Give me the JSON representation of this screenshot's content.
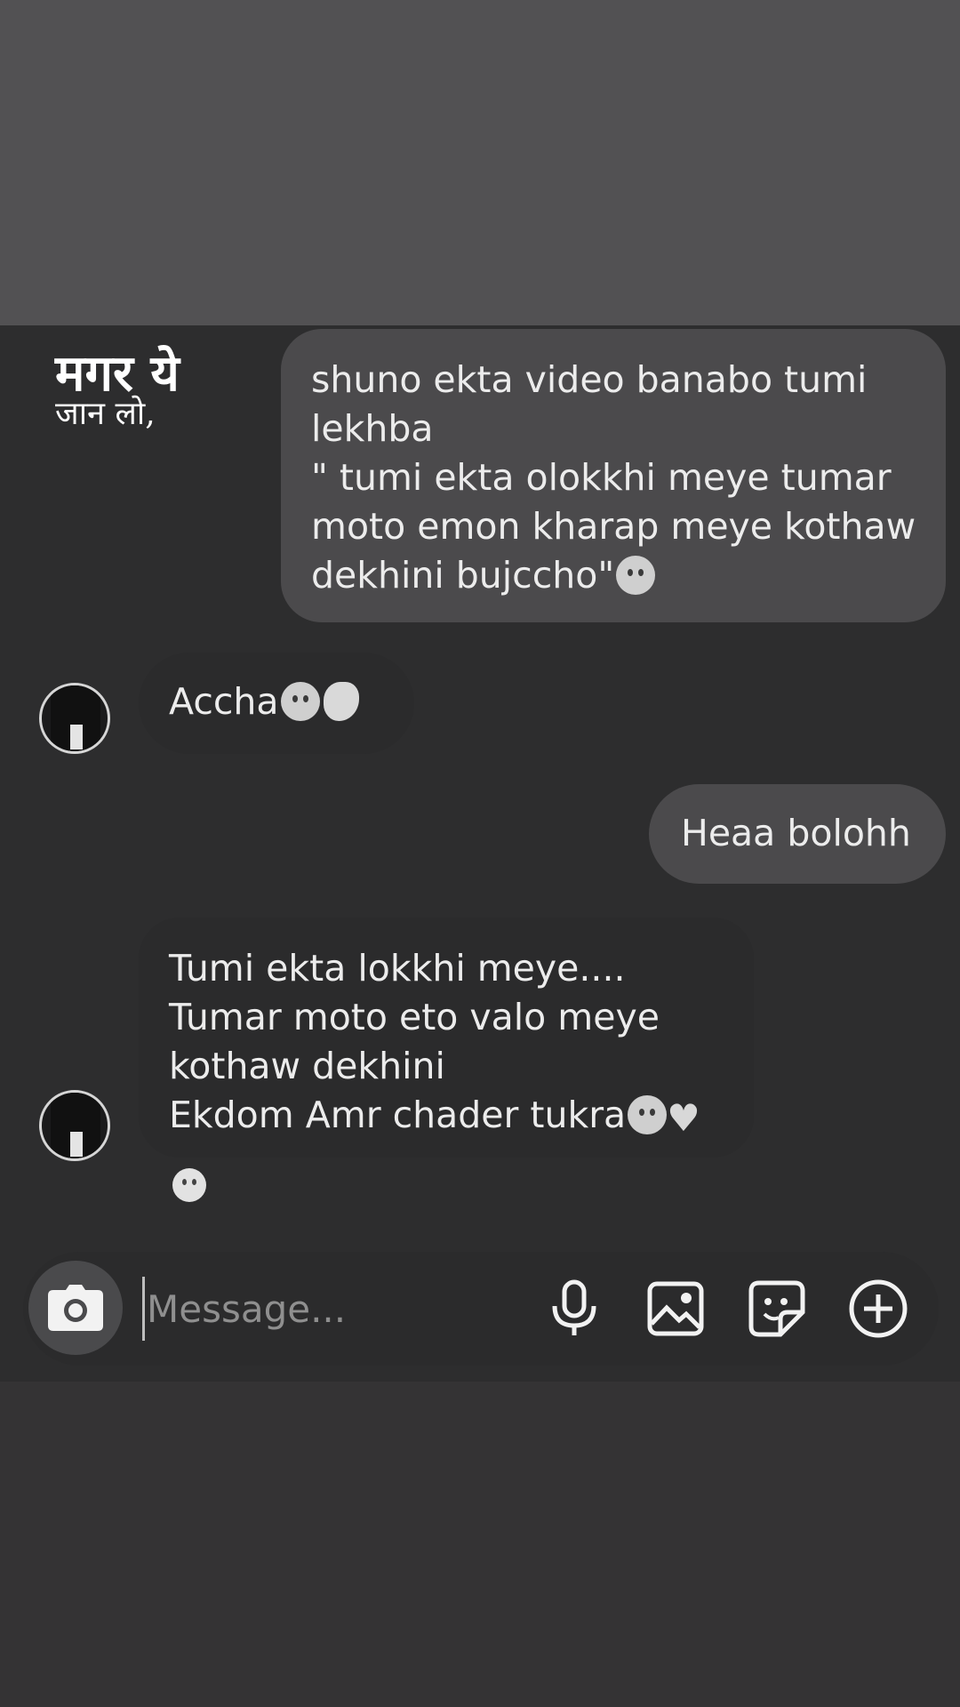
{
  "overlay": {
    "line1": "मगर ये",
    "line2": "जान लो,"
  },
  "messages": [
    {
      "direction": "sent",
      "text": "shuno ekta video banabo tumi lekhba\n\" tumi ekta olokkhi meye tumar moto emon kharap meye kothaw dekhini bujccho\"",
      "emojis": [
        "ghost"
      ]
    },
    {
      "direction": "received",
      "text": "Accha",
      "emojis": [
        "ghost",
        "ok-hand"
      ]
    },
    {
      "direction": "sent",
      "text": "Heaa bolohh",
      "emojis": []
    },
    {
      "direction": "received",
      "text": "Tumi ekta lokkhi meye....\nTumar moto eto valo meye kothaw dekhini\nEkdom Amr chader tukra",
      "emojis": [
        "ghost",
        "white-heart"
      ],
      "reaction": "slightly-smiling-face"
    }
  ],
  "composer": {
    "placeholder": "Message...",
    "icons": [
      "camera-icon",
      "microphone-icon",
      "gallery-icon",
      "sticker-icon",
      "plus-circle-icon"
    ]
  },
  "colors": {
    "top_band": "#525153",
    "chat_background": "#2d2d2e",
    "sent_bubble": "#4b4a4c",
    "received_bubble": "#2b2b2c",
    "text": "#ececec"
  }
}
